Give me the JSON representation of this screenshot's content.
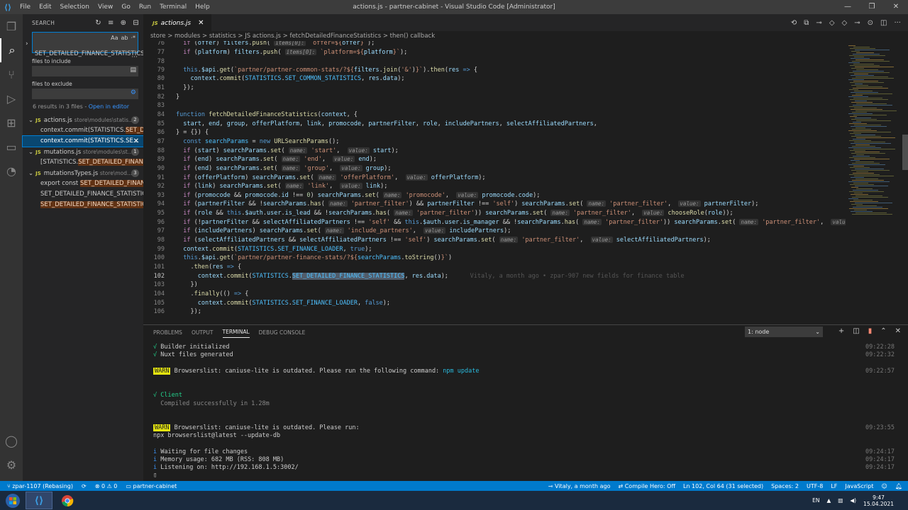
{
  "window": {
    "title": "actions.js - partner-cabinet - Visual Studio Code [Administrator]",
    "menu": [
      "File",
      "Edit",
      "Selection",
      "View",
      "Go",
      "Run",
      "Terminal",
      "Help"
    ]
  },
  "sidebar": {
    "header": "SEARCH",
    "search_value": "SET_DETAILED_FINANCE_STATISTICS",
    "search_opts": [
      "Aa",
      "ab",
      "·*"
    ],
    "files_include_label": "files to include",
    "files_exclude_label": "files to exclude",
    "result_summary": "6 results in 3 files - ",
    "open_in_editor": "Open in editor",
    "files": [
      {
        "name": "actions.js",
        "path": "store\\modules\\statis...",
        "count": "2",
        "matches": [
          {
            "pre": "context.commit(STATISTICS.",
            "hit": "SET_DET..."
          },
          {
            "pre": "context.commit(STATISTICS.SE...",
            "hit": ""
          }
        ]
      },
      {
        "name": "mutations.js",
        "path": "store\\modules\\st...",
        "count": "1",
        "matches": [
          {
            "pre": "[STATISTICS.",
            "hit": "SET_DETAILED_FINANC..."
          }
        ]
      },
      {
        "name": "mutationsTypes.js",
        "path": "store\\mod...",
        "count": "3",
        "matches": [
          {
            "pre": "export const ",
            "hit": "SET_DETAILED_FINANC..."
          },
          {
            "pre": "SET_DETAILED_FINANCE_STATISTIC...",
            "hit": ""
          },
          {
            "pre": "",
            "hit": "SET_DETAILED_FINANCE_STATISTICS."
          }
        ]
      }
    ]
  },
  "editor": {
    "tab": "actions.js",
    "breadcrumb": "store > modules > statistics > JS actions.js > fetchDetailedFinanceStatistics > then() callback",
    "line_numbers": [
      "76",
      "77",
      "78",
      "79",
      "80",
      "81",
      "82",
      "83",
      "84",
      "85",
      "86",
      "87",
      "88",
      "89",
      "90",
      "91",
      "92",
      "93",
      "94",
      "95",
      "96",
      "97",
      "98",
      "99",
      "100",
      "101",
      "102",
      "103",
      "104",
      "105",
      "106"
    ],
    "current_line": "102",
    "blame": "Vitaly, a month ago • zpar-907 new fields for finance table"
  },
  "panel": {
    "tabs": [
      "PROBLEMS",
      "OUTPUT",
      "TERMINAL",
      "DEBUG CONSOLE"
    ],
    "active_tab": "TERMINAL",
    "terminal_select": "1: node",
    "terminal": {
      "builder": "Builder initialized",
      "builder_time": "09:22:28",
      "nuxt": "Nuxt files generated",
      "nuxt_time": "09:22:32",
      "warn_tag": "WARN",
      "warn1": " Browserslist: caniuse-lite is outdated. Please run the following command: ",
      "warn1_cmd": "npm update",
      "warn1_time": "09:22:57",
      "client": "Client",
      "compiled": "Compiled successfully in 1.28m",
      "warn2": " Browserslist: caniuse-lite is outdated. Please run:",
      "warn2_cmd": "npx browserslist@latest --update-db",
      "warn2_time": "09:23:55",
      "waiting": "Waiting for file changes",
      "waiting_time": "09:24:17",
      "memory": "Memory usage: 682 MB (RSS: 808 MB)",
      "memory_time": "09:24:17",
      "listening": "Listening on: http://192.168.1.5:3002/",
      "listening_time": "09:24:17"
    }
  },
  "statusbar": {
    "branch": "zpar-1107 (Rebasing)",
    "problems": "0 ⚠ 0",
    "project": "partner-cabinet",
    "blame": "Vitaly, a month ago",
    "compile_hero": "Compile Hero: Off",
    "position": "Ln 102, Col 64 (31 selected)",
    "spaces": "Spaces: 2",
    "encoding": "UTF-8",
    "eol": "LF",
    "language": "JavaScript"
  },
  "taskbar": {
    "lang": "EN",
    "time": "9:47",
    "date": "15.04.2021"
  },
  "colors": {
    "statusbar": "#007acc",
    "accent": "#007fd4",
    "activity": "#333333",
    "sidebar": "#252526"
  }
}
